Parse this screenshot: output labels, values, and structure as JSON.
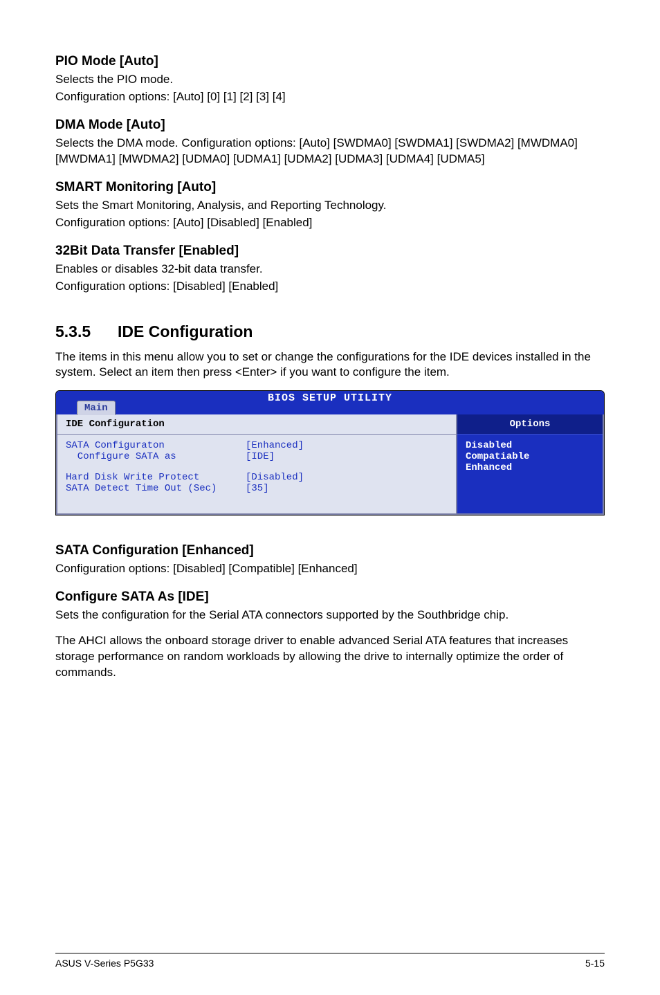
{
  "sections": {
    "pio": {
      "heading": "PIO Mode [Auto]",
      "line1": "Selects the PIO mode.",
      "line2": "Configuration options: [Auto] [0] [1] [2] [3] [4]"
    },
    "dma": {
      "heading": "DMA Mode [Auto]",
      "text": "Selects the DMA mode. Configuration options: [Auto] [SWDMA0] [SWDMA1] [SWDMA2] [MWDMA0] [MWDMA1] [MWDMA2] [UDMA0] [UDMA1] [UDMA2] [UDMA3] [UDMA4] [UDMA5]"
    },
    "smart": {
      "heading": "SMART Monitoring [Auto]",
      "line1": "Sets the Smart Monitoring, Analysis, and Reporting Technology.",
      "line2": "Configuration options: [Auto] [Disabled] [Enabled]"
    },
    "xfer": {
      "heading": "32Bit Data Transfer [Enabled]",
      "line1": "Enables or disables 32-bit data transfer.",
      "line2": "Configuration options: [Disabled] [Enabled]"
    },
    "ide": {
      "number": "5.3.5",
      "title": "IDE Configuration",
      "intro": "The items in this menu allow you to set or change the configurations for the IDE devices installed in the system. Select an item then press <Enter> if you want to configure the item."
    },
    "sata_cfg": {
      "heading": "SATA Configuration [Enhanced]",
      "text": "Configuration options: [Disabled] [Compatible] [Enhanced]"
    },
    "cfg_sata_as": {
      "heading": "Configure SATA As [IDE]",
      "p1": "Sets the configuration for the Serial ATA connectors supported by the Southbridge chip.",
      "p2": "The AHCI allows the onboard storage driver to enable advanced Serial ATA features that increases storage performance on random workloads by allowing the drive to internally optimize the order of commands."
    }
  },
  "bios": {
    "title": "BIOS SETUP UTILITY",
    "tab": "Main",
    "left_title": "IDE Configuration",
    "rows": [
      {
        "label": "SATA Configuraton",
        "value": "[Enhanced]"
      },
      {
        "label": "  Configure SATA as",
        "value": "[IDE]"
      },
      {
        "label": "",
        "value": ""
      },
      {
        "label": "Hard Disk Write Protect",
        "value": "[Disabled]"
      },
      {
        "label": "SATA Detect Time Out (Sec)",
        "value": "[35]"
      }
    ],
    "right_title": "Options",
    "right_lines": [
      "Disabled",
      "Compatiable",
      "Enhanced"
    ]
  },
  "footer": {
    "left": "ASUS V-Series P5G33",
    "right": "5-15"
  }
}
